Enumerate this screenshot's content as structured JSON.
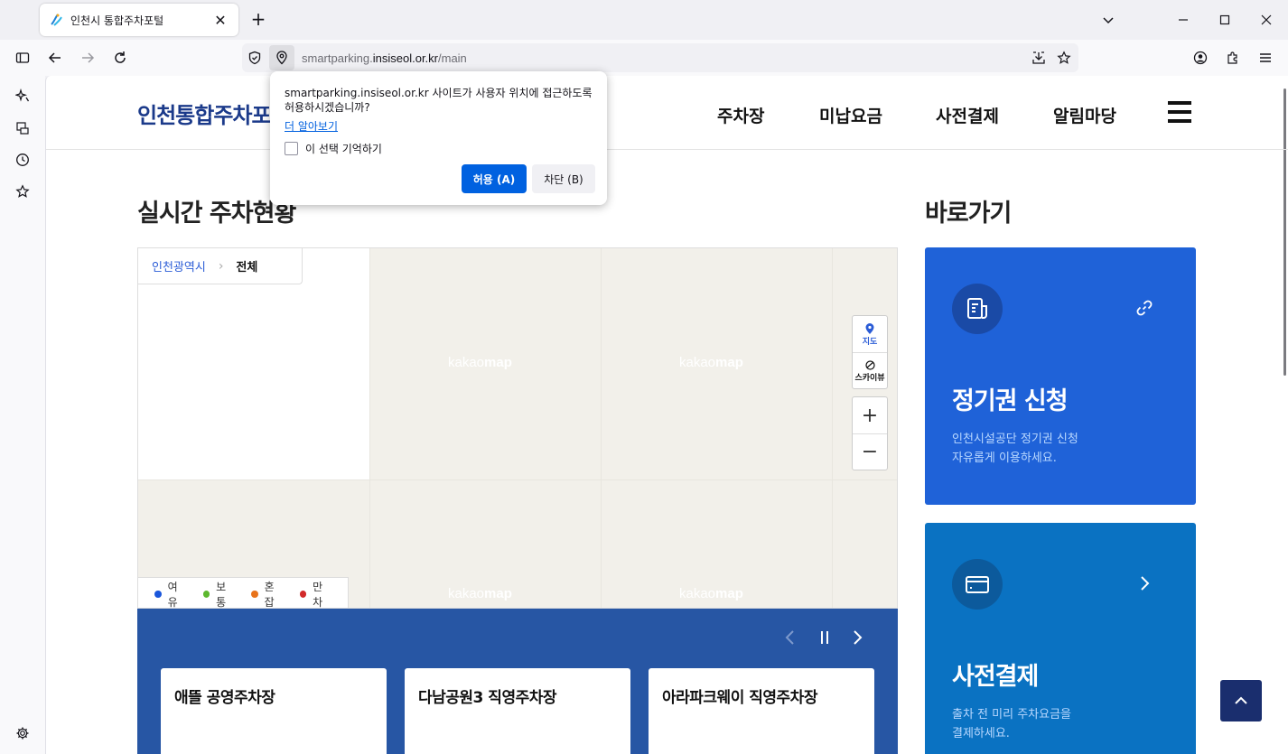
{
  "browser": {
    "tab_title": "인천시 통합주차포털",
    "url_prefix": "smartparking.",
    "url_domain": "insiseol.or.kr",
    "url_path": "/main"
  },
  "popup": {
    "message": "smartparking.insiseol.or.kr 사이트가 사용자 위치에 접근하도록 허용하시겠습니까?",
    "learn_more": "더 알아보기",
    "remember_label": "이 선택 기억하기",
    "allow_label": "허용 (A)",
    "block_label": "차단 (B)"
  },
  "header": {
    "logo": "인천통합주차포털",
    "nav": [
      "주차장",
      "미납요금",
      "사전결제",
      "알림마당"
    ]
  },
  "realtime": {
    "title": "실시간 주차현황",
    "breadcrumb_city": "인천광역시",
    "breadcrumb_current": "전체",
    "maptype_map": "지도",
    "maptype_sky": "스카이뷰",
    "zoom_in": "+",
    "zoom_out": "−",
    "watermark_a": "kakao",
    "watermark_b": "map",
    "legend": [
      {
        "label": "여유",
        "color": "#1a56db"
      },
      {
        "label": "보통",
        "color": "#5cb82e"
      },
      {
        "label": "혼잡",
        "color": "#e8731a"
      },
      {
        "label": "만차",
        "color": "#d22a2a"
      }
    ],
    "parking_lots": [
      "애뜰 공영주차장",
      "다남공원3 직영주차장",
      "아라파크웨이 직영주차장"
    ]
  },
  "shortcuts": {
    "title": "바로가기",
    "cards": [
      {
        "title": "정기권 신청",
        "desc_line1": "인천시설공단 정기권 신청",
        "desc_line2": "자유롭게 이용하세요.",
        "bg": "#1f62d8",
        "icon_bg": "#1a4aa6"
      },
      {
        "title": "사전결제",
        "desc_line1": "출차 전 미리 주차요금을",
        "desc_line2": "결제하세요.",
        "bg": "#0a72c2",
        "icon_bg": "#0c5a9c"
      }
    ]
  }
}
